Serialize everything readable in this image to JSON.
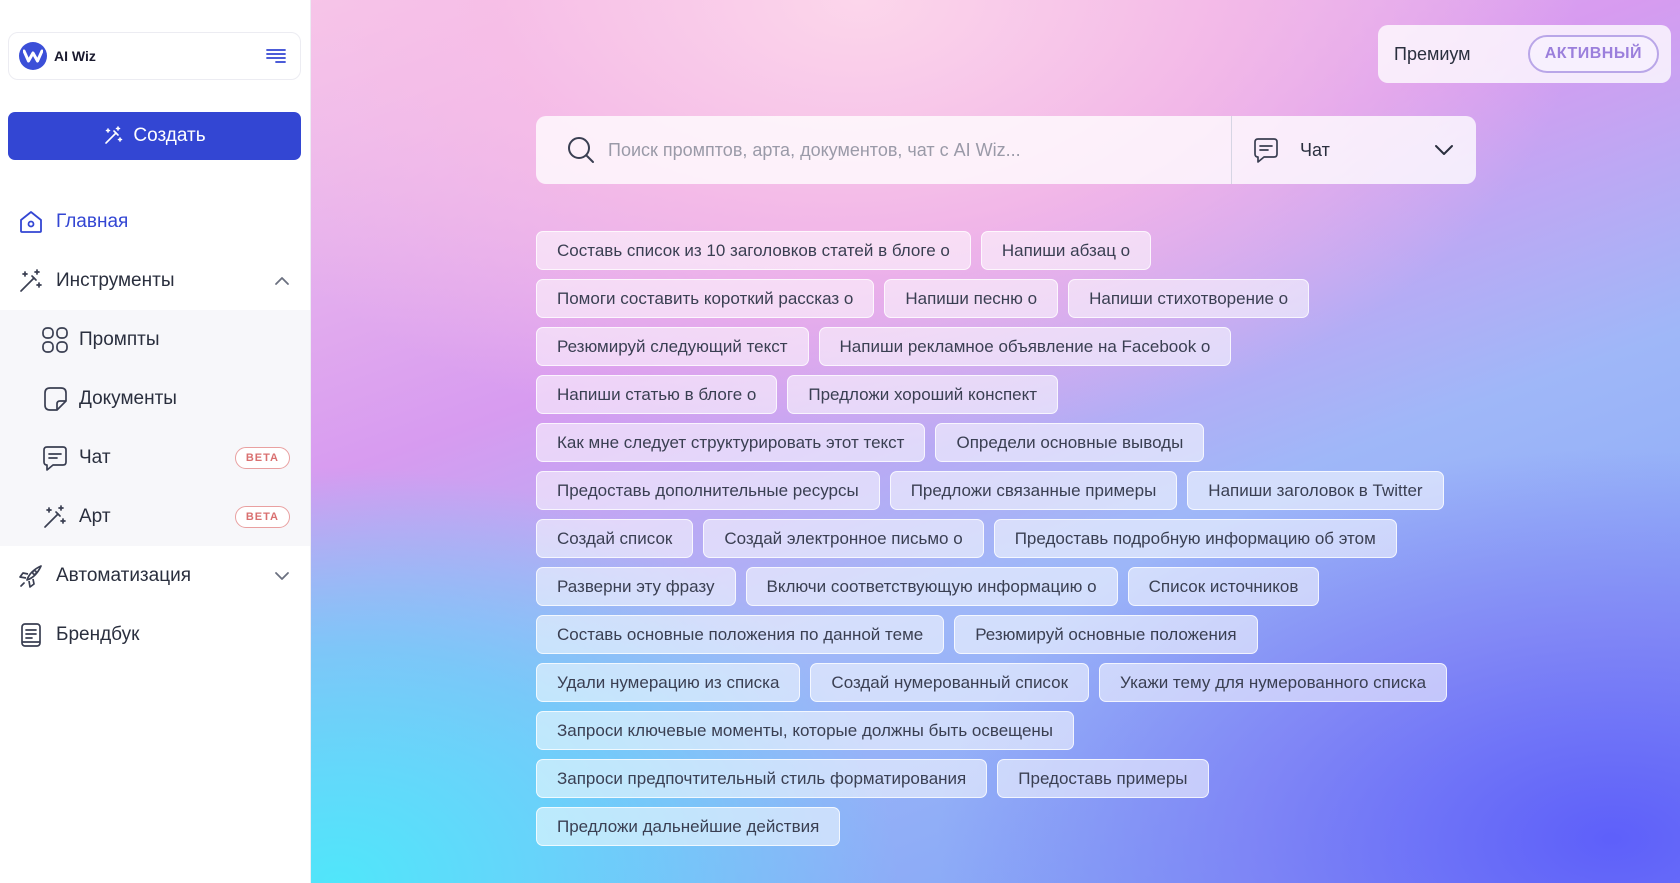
{
  "app": {
    "name": "AI Wiz"
  },
  "sidebar": {
    "create_label": "Создать",
    "items": [
      {
        "label": "Главная"
      },
      {
        "label": "Инструменты"
      },
      {
        "label": "Промпты"
      },
      {
        "label": "Документы"
      },
      {
        "label": "Чат",
        "badge": "BETA"
      },
      {
        "label": "Арт",
        "badge": "BETA"
      },
      {
        "label": "Автоматизация"
      },
      {
        "label": "Брендбук"
      }
    ]
  },
  "header": {
    "premium_label": "Премиум",
    "status_badge": "АКТИВНЫЙ"
  },
  "search": {
    "placeholder": "Поиск промптов, арта, документов, чат с AI Wiz...",
    "mode": "Чат"
  },
  "colors": {
    "accent": "#3346d3",
    "beta": "#d97070",
    "active_badge": "#9b7fdc"
  },
  "chips": [
    [
      "Составь список из 10 заголовков статей в блоге о",
      "Напиши абзац о"
    ],
    [
      "Помоги составить короткий рассказ о",
      "Напиши песню о",
      "Напиши стихотворение о"
    ],
    [
      "Резюмируй следующий текст",
      "Напиши рекламное объявление на Facebook о"
    ],
    [
      "Напиши статью в блоге о",
      "Предложи хороший конспект"
    ],
    [
      "Как мне следует структурировать этот текст",
      "Определи основные выводы"
    ],
    [
      "Предоставь дополнительные ресурсы",
      "Предложи связанные примеры",
      "Напиши заголовок в Twitter"
    ],
    [
      "Создай список",
      "Создай электронное письмо о",
      "Предоставь подробную информацию об этом"
    ],
    [
      "Разверни эту фразу",
      "Включи соответствующую информацию о",
      "Список источников"
    ],
    [
      "Составь основные положения по данной теме",
      "Резюмируй основные положения"
    ],
    [
      "Удали нумерацию из списка",
      "Создай нумерованный список",
      "Укажи тему для нумерованного списка"
    ],
    [
      "Запроси ключевые моменты, которые должны быть освещены"
    ],
    [
      "Запроси предпочтительный стиль форматирования",
      "Предоставь примеры"
    ],
    [
      "Предложи дальнейшие действия"
    ]
  ]
}
